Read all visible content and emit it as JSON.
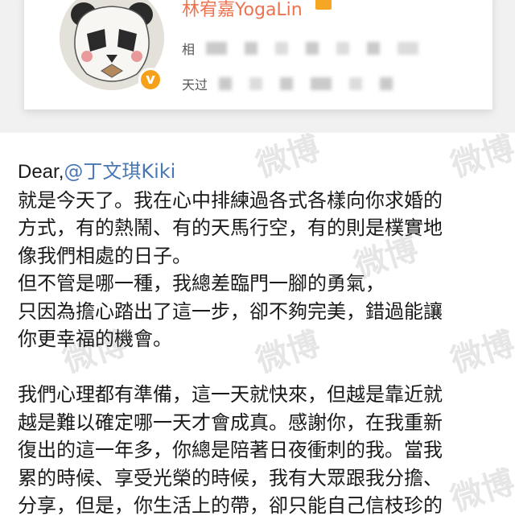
{
  "profile": {
    "username": "林宥嘉YogaLin",
    "preview_line1": "相",
    "preview_line2": "天过"
  },
  "post": {
    "greeting": "Dear,",
    "mention": "@丁文琪Kiki",
    "paragraph1": [
      "就是今天了。我在心中排練過各式各樣向你求婚的",
      "方式，有的熱鬧、有的天馬行空，有的則是樸實地",
      "像我們相處的日子。",
      "但不管是哪一種，我總差臨門一腳的勇氣，",
      "只因為擔心踏出了這一步，卻不夠完美，錯過能讓",
      "你更幸福的機會。"
    ],
    "paragraph2": [
      "我們心理都有準備，這一天就快來，但越是靠近就",
      "越是難以確定哪一天才會成真。感謝你，在我重新",
      "復出的這一年多，你總是陪著日夜衝刺的我。當我",
      "累的時候、享受光榮的時候，我有大眾跟我分擔、",
      "分享，但是，你生活上的帶，卻只能自己信枝珍的"
    ]
  },
  "watermark": {
    "text": "微博",
    "subtext": "weibo.com"
  },
  "colors": {
    "username": "#eb7350",
    "mention": "#4a78b4",
    "verified_badge": "#f5a21a"
  }
}
